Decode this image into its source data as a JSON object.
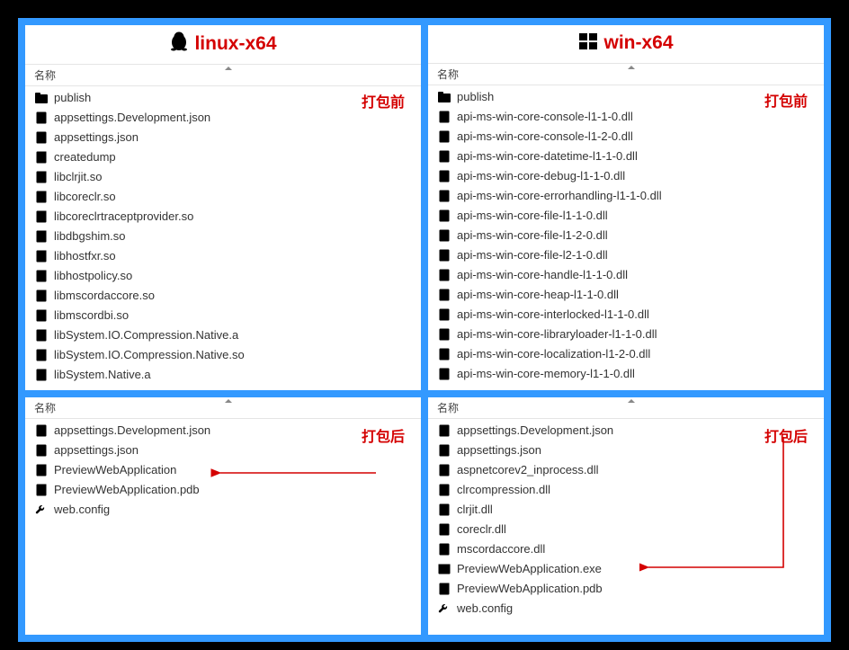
{
  "titles": {
    "linux": "linux-x64",
    "win": "win-x64"
  },
  "header_label": "名称",
  "badges": {
    "before": "打包前",
    "after": "打包后"
  },
  "panels": {
    "linux_before": [
      {
        "icon": "folder",
        "name": "publish"
      },
      {
        "icon": "json",
        "name": "appsettings.Development.json"
      },
      {
        "icon": "json",
        "name": "appsettings.json"
      },
      {
        "icon": "file",
        "name": "createdump"
      },
      {
        "icon": "file",
        "name": "libclrjit.so"
      },
      {
        "icon": "file",
        "name": "libcoreclr.so"
      },
      {
        "icon": "file",
        "name": "libcoreclrtraceptprovider.so"
      },
      {
        "icon": "file",
        "name": "libdbgshim.so"
      },
      {
        "icon": "file",
        "name": "libhostfxr.so"
      },
      {
        "icon": "file",
        "name": "libhostpolicy.so"
      },
      {
        "icon": "file",
        "name": "libmscordaccore.so"
      },
      {
        "icon": "file",
        "name": "libmscordbi.so"
      },
      {
        "icon": "file",
        "name": "libSystem.IO.Compression.Native.a"
      },
      {
        "icon": "file",
        "name": "libSystem.IO.Compression.Native.so"
      },
      {
        "icon": "file",
        "name": "libSystem.Native.a"
      }
    ],
    "win_before": [
      {
        "icon": "folder",
        "name": "publish"
      },
      {
        "icon": "gear",
        "name": "api-ms-win-core-console-l1-1-0.dll"
      },
      {
        "icon": "gear",
        "name": "api-ms-win-core-console-l1-2-0.dll"
      },
      {
        "icon": "gear",
        "name": "api-ms-win-core-datetime-l1-1-0.dll"
      },
      {
        "icon": "gear",
        "name": "api-ms-win-core-debug-l1-1-0.dll"
      },
      {
        "icon": "gear",
        "name": "api-ms-win-core-errorhandling-l1-1-0.dll"
      },
      {
        "icon": "gear",
        "name": "api-ms-win-core-file-l1-1-0.dll"
      },
      {
        "icon": "gear",
        "name": "api-ms-win-core-file-l1-2-0.dll"
      },
      {
        "icon": "gear",
        "name": "api-ms-win-core-file-l2-1-0.dll"
      },
      {
        "icon": "gear",
        "name": "api-ms-win-core-handle-l1-1-0.dll"
      },
      {
        "icon": "gear",
        "name": "api-ms-win-core-heap-l1-1-0.dll"
      },
      {
        "icon": "gear",
        "name": "api-ms-win-core-interlocked-l1-1-0.dll"
      },
      {
        "icon": "gear",
        "name": "api-ms-win-core-libraryloader-l1-1-0.dll"
      },
      {
        "icon": "gear",
        "name": "api-ms-win-core-localization-l1-2-0.dll"
      },
      {
        "icon": "gear",
        "name": "api-ms-win-core-memory-l1-1-0.dll"
      }
    ],
    "linux_after": [
      {
        "icon": "json",
        "name": "appsettings.Development.json"
      },
      {
        "icon": "json",
        "name": "appsettings.json"
      },
      {
        "icon": "file",
        "name": "PreviewWebApplication",
        "highlight": true
      },
      {
        "icon": "file",
        "name": "PreviewWebApplication.pdb"
      },
      {
        "icon": "wrench",
        "name": "web.config"
      }
    ],
    "win_after": [
      {
        "icon": "json",
        "name": "appsettings.Development.json"
      },
      {
        "icon": "json",
        "name": "appsettings.json"
      },
      {
        "icon": "gear",
        "name": "aspnetcorev2_inprocess.dll"
      },
      {
        "icon": "gear",
        "name": "clrcompression.dll"
      },
      {
        "icon": "gear",
        "name": "clrjit.dll"
      },
      {
        "icon": "gear",
        "name": "coreclr.dll"
      },
      {
        "icon": "gear",
        "name": "mscordaccore.dll"
      },
      {
        "icon": "exe",
        "name": "PreviewWebApplication.exe",
        "highlight": true
      },
      {
        "icon": "file",
        "name": "PreviewWebApplication.pdb"
      },
      {
        "icon": "wrench",
        "name": "web.config"
      }
    ]
  }
}
